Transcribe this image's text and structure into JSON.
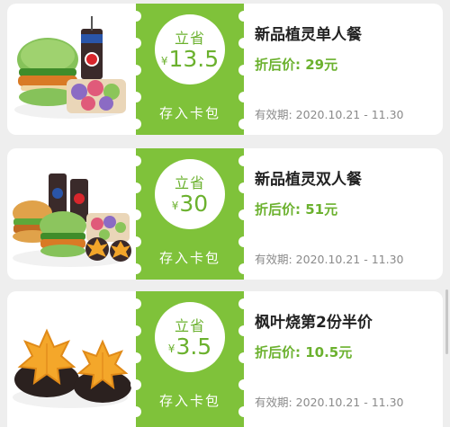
{
  "coupons": [
    {
      "image": "burger-combo-single",
      "save_label": "立省",
      "currency": "¥",
      "amount": "13.5",
      "store_label": "存入卡包",
      "title": "新品植灵单人餐",
      "price_label": "折后价: ",
      "price": "29元",
      "validity": "有效期: 2020.10.21 - 11.30"
    },
    {
      "image": "burger-combo-double",
      "save_label": "立省",
      "currency": "¥",
      "amount": "30",
      "store_label": "存入卡包",
      "title": "新品植灵双人餐",
      "price_label": "折后价: ",
      "price": "51元",
      "validity": "有效期: 2020.10.21 - 11.30"
    },
    {
      "image": "maple-leaf-cakes",
      "save_label": "立省",
      "currency": "¥",
      "amount": "3.5",
      "store_label": "存入卡包",
      "title": "枫叶烧第2份半价",
      "price_label": "折后价: ",
      "price": "10.5元",
      "validity": "有效期: 2020.10.21 - 11.30"
    }
  ],
  "colors": {
    "accent": "#7fc23a",
    "accent_text": "#6bb12e",
    "background": "#eeeeee"
  }
}
